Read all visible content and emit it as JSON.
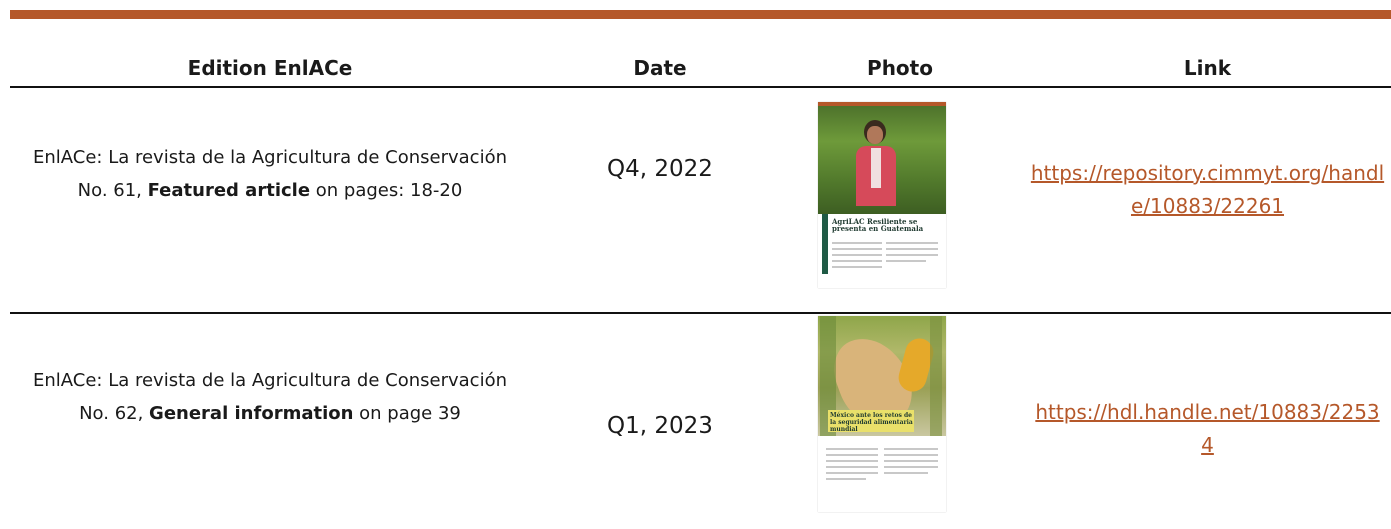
{
  "headers": {
    "edition": "Edition EnlACe",
    "date": "Date",
    "photo": "Photo",
    "link": "Link"
  },
  "rows": [
    {
      "edition_text": "EnlACe: La revista de la Agricultura de Conservación No. 61, ",
      "edition_bold": "Featured article",
      "edition_tail": " on pages: 18-20",
      "date": "Q4, 2022",
      "link": "https://repository.cimmyt.org/handle/10883/22261",
      "photo": {
        "headline": "AgriLAC Resiliente se presenta en Guatemala",
        "icon": "magazine-page-woman-in-cornfield"
      }
    },
    {
      "edition_text": "EnlACe: La revista de la Agricultura de Conservación No. 62, ",
      "edition_bold": "General information",
      "edition_tail": " on page 39",
      "date": "Q1, 2023",
      "link": "https://hdl.handle.net/10883/22534",
      "photo": {
        "headline": "México ante los retos de la seguridad alimentaria mundial",
        "icon": "magazine-page-corn-ear"
      }
    }
  ],
  "colors": {
    "accent": "#b5582a",
    "rule": "#111111"
  }
}
